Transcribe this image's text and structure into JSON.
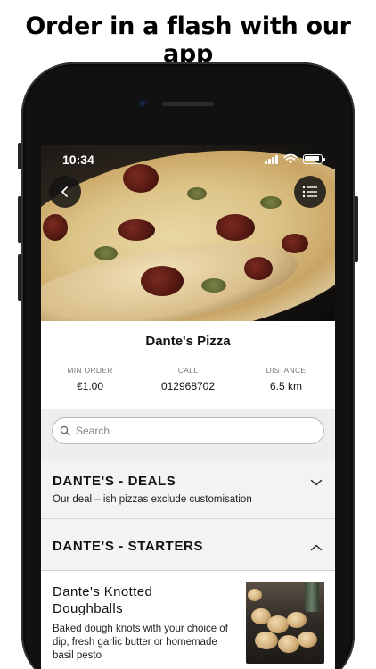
{
  "headline": "Order in a flash with our app",
  "status_bar": {
    "time": "10:34"
  },
  "hero": {
    "image": "pizza-photo"
  },
  "restaurant": {
    "name": "Dante's Pizza",
    "stats": [
      {
        "label": "MIN ORDER",
        "value": "€1.00"
      },
      {
        "label": "CALL",
        "value": "012968702"
      },
      {
        "label": "DISTANCE",
        "value": "6.5 km"
      }
    ]
  },
  "search": {
    "placeholder": "Search"
  },
  "categories": [
    {
      "title": "DANTE'S - DEALS",
      "subtitle": "Our deal – ish pizzas exclude customisation",
      "expanded": false
    },
    {
      "title": "DANTE'S - STARTERS",
      "expanded": true
    }
  ],
  "item": {
    "name": "Dante's Knotted Doughballs",
    "description": "Baked dough knots with your choice of dip, fresh garlic butter or homemade basil pesto"
  }
}
